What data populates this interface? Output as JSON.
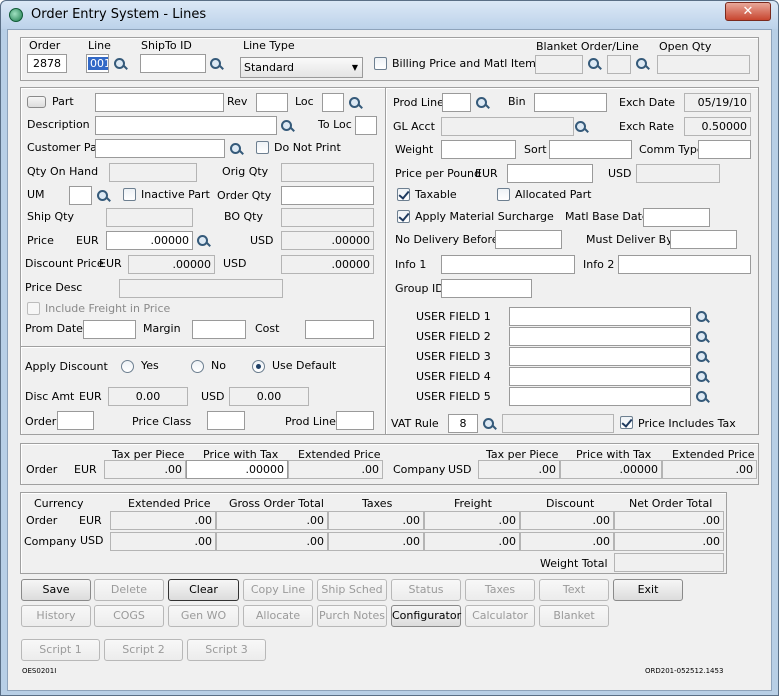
{
  "window": {
    "title": "Order Entry System - Lines",
    "close_label": "✕"
  },
  "header": {
    "order_label": "Order",
    "order_value": "2878",
    "line_label": "Line",
    "line_value": "001",
    "shipto_label": "ShipTo ID",
    "shipto_value": "",
    "linetype_label": "Line Type",
    "linetype_value": "Standard",
    "billing_label": "Billing Price and Matl Item",
    "blanket_label": "Blanket Order/Line",
    "openqty_label": "Open Qty"
  },
  "left": {
    "part_label": "Part",
    "rev_label": "Rev",
    "loc_label": "Loc",
    "description_label": "Description",
    "toloc_label": "To Loc",
    "custpart_label": "Customer Part",
    "donotprint_label": "Do Not Print",
    "qtyonhand_label": "Qty On Hand",
    "origqty_label": "Orig Qty",
    "um_label": "UM",
    "inactive_label": "Inactive Part",
    "orderqty_label": "Order Qty",
    "shipqty_label": "Ship Qty",
    "boqty_label": "BO Qty",
    "price_label": "Price",
    "eur": "EUR",
    "usd": "USD",
    "price_eur": ".00000",
    "price_usd": ".00000",
    "discprice_label": "Discount Price",
    "discprice_eur": ".00000",
    "discprice_usd": ".00000",
    "pricedesc_label": "Price Desc",
    "freight_label": "Include Freight in Price",
    "promdate_label": "Prom Date",
    "margin_label": "Margin",
    "cost_label": "Cost"
  },
  "discount": {
    "apply_label": "Apply Discount",
    "yes": "Yes",
    "no": "No",
    "default": "Use Default",
    "discamt_label": "Disc Amt",
    "eur": "EUR",
    "usd": "USD",
    "amt_eur": "0.00",
    "amt_usd": "0.00",
    "order_label": "Order",
    "priceclass_label": "Price Class",
    "prodline_label": "Prod Line"
  },
  "right": {
    "prodline_label": "Prod Line",
    "bin_label": "Bin",
    "exchdate_label": "Exch Date",
    "exchdate_value": "05/19/10",
    "glacct_label": "GL Acct",
    "exchrate_label": "Exch Rate",
    "exchrate_value": "0.50000",
    "weight_label": "Weight",
    "sort_label": "Sort",
    "commtype_label": "Comm Type",
    "ppp_label": "Price per Pound",
    "eur": "EUR",
    "usd": "USD",
    "taxable_label": "Taxable",
    "allocated_label": "Allocated Part",
    "surcharge_label": "Apply Material Surcharge",
    "matlbase_label": "Matl Base Date",
    "nodelivery_label": "No Delivery Before",
    "mustdeliver_label": "Must Deliver By",
    "info1_label": "Info 1",
    "info2_label": "Info 2",
    "groupid_label": "Group ID",
    "uf1": "USER FIELD 1",
    "uf2": "USER FIELD 2",
    "uf3": "USER FIELD 3",
    "uf4": "USER FIELD 4",
    "uf5": "USER FIELD 5",
    "vatrule_label": "VAT Rule",
    "vatrule_value": "8",
    "priceincl_label": "Price Includes Tax"
  },
  "tax": {
    "tpp_label": "Tax per Piece",
    "pwt_label": "Price with Tax",
    "ext_label": "Extended Price",
    "order_label": "Order",
    "eur": "EUR",
    "company_label": "Company",
    "usd": "USD",
    "order_tpp": ".00",
    "order_pwt": ".00000",
    "order_ext": ".00",
    "comp_tpp": ".00",
    "comp_pwt": ".00000",
    "comp_ext": ".00"
  },
  "totals": {
    "currency_label": "Currency",
    "ext_label": "Extended Price",
    "gross_label": "Gross Order Total",
    "taxes_label": "Taxes",
    "freight_label": "Freight",
    "discount_label": "Discount",
    "net_label": "Net Order Total",
    "order_label": "Order",
    "eur": "EUR",
    "company_label": "Company",
    "usd": "USD",
    "order_values": [
      ".00",
      ".00",
      ".00",
      ".00",
      ".00",
      ".00"
    ],
    "company_values": [
      ".00",
      ".00",
      ".00",
      ".00",
      ".00",
      ".00"
    ],
    "weight_label": "Weight Total"
  },
  "buttons": {
    "row1": [
      "Save",
      "Delete",
      "Clear",
      "Copy Line",
      "Ship Sched",
      "Status",
      "Taxes",
      "Text",
      "Exit"
    ],
    "row2": [
      "History",
      "COGS",
      "Gen WO",
      "Allocate",
      "Purch Notes",
      "Configurator",
      "Calculator",
      "Blanket"
    ],
    "scripts": [
      "Script 1",
      "Script 2",
      "Script 3"
    ]
  },
  "footer": {
    "left_code": "OES0201I",
    "right_code": "ORD201-052512.1453"
  }
}
